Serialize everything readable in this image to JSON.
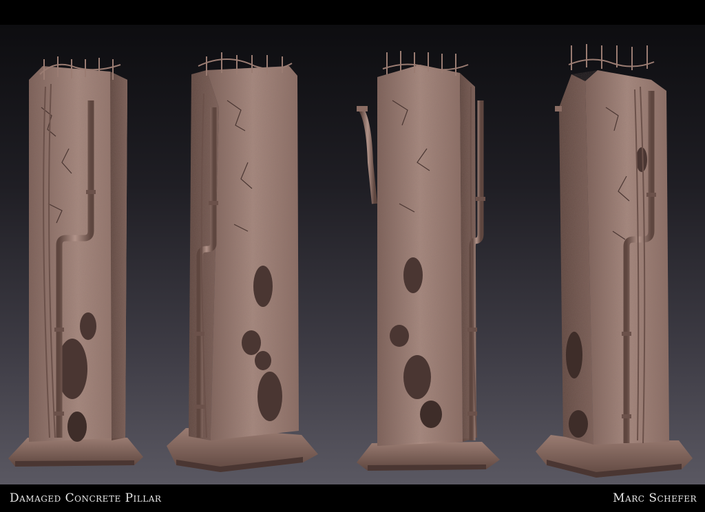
{
  "render": {
    "title": "Damaged Concrete Pillar",
    "author": "Marc Schefer"
  },
  "colors": {
    "clay_light": "#a88a80",
    "clay_mid": "#8a6c63",
    "clay_dark": "#5e463f",
    "clay_shadow": "#3e2d29",
    "background_top": "#0d0d10",
    "background_bottom": "#5a5862",
    "caption_text": "#e8e8e8"
  },
  "views": [
    {
      "name": "front-view"
    },
    {
      "name": "three-quarter-left-view"
    },
    {
      "name": "back-view"
    },
    {
      "name": "three-quarter-right-view"
    }
  ]
}
